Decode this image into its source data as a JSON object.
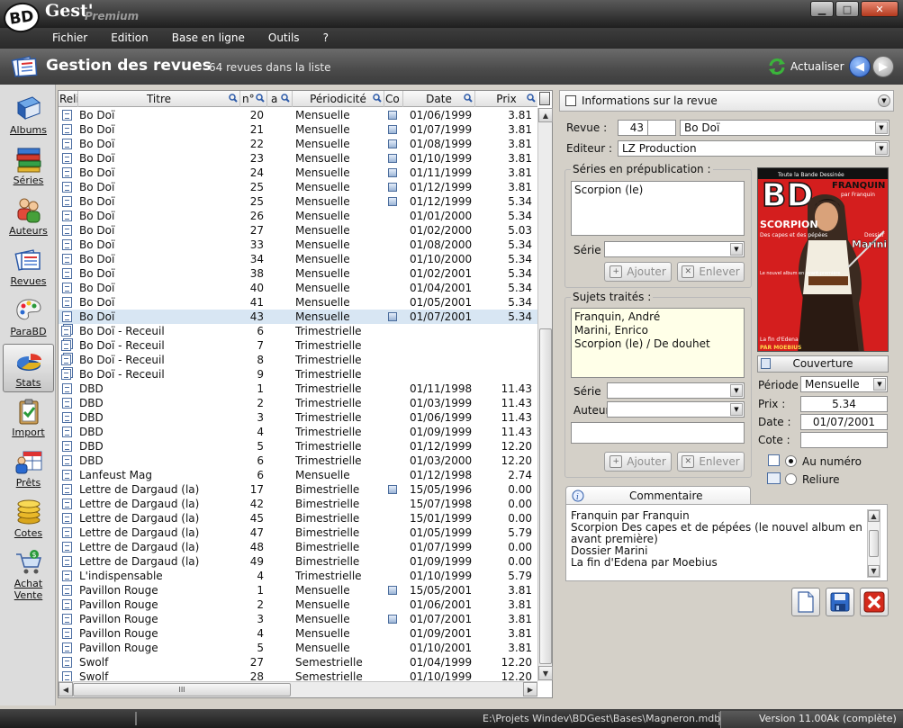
{
  "titlebar": {
    "logo_bd": "BD",
    "logo_gest": "Gest'",
    "logo_premium": "Premium"
  },
  "menu": [
    "Fichier",
    "Edition",
    "Base en ligne",
    "Outils",
    "?"
  ],
  "header": {
    "title": "Gestion des revues",
    "count": "64 revues dans la liste",
    "refresh": "Actualiser"
  },
  "sidebar": [
    {
      "label": "Albums",
      "icon": "book-icon"
    },
    {
      "label": "Séries",
      "icon": "stack-books-icon"
    },
    {
      "label": "Auteurs",
      "icon": "people-icon"
    },
    {
      "label": "Revues",
      "icon": "magazine-icon"
    },
    {
      "label": "ParaBD",
      "icon": "palette-icon"
    },
    {
      "label": "Stats",
      "icon": "pie-chart-icon"
    },
    {
      "label": "Import",
      "icon": "clipboard-icon"
    },
    {
      "label": "Prêts",
      "icon": "calendar-person-icon"
    },
    {
      "label": "Cotes",
      "icon": "coins-icon"
    },
    {
      "label": "Achat Vente",
      "icon": "cart-icon"
    }
  ],
  "list": {
    "columns": [
      "Reli",
      "Titre",
      "n°",
      "a",
      "Périodicité",
      "Co",
      "Date",
      "Prix"
    ],
    "rows": [
      [
        "Bo Doï",
        "20",
        "Mensuelle",
        "c",
        "01/06/1999",
        "3.81"
      ],
      [
        "Bo Doï",
        "21",
        "Mensuelle",
        "c",
        "01/07/1999",
        "3.81"
      ],
      [
        "Bo Doï",
        "22",
        "Mensuelle",
        "c",
        "01/08/1999",
        "3.81"
      ],
      [
        "Bo Doï",
        "23",
        "Mensuelle",
        "c",
        "01/10/1999",
        "3.81"
      ],
      [
        "Bo Doï",
        "24",
        "Mensuelle",
        "c",
        "01/11/1999",
        "3.81"
      ],
      [
        "Bo Doï",
        "25",
        "Mensuelle",
        "c",
        "01/12/1999",
        "3.81"
      ],
      [
        "Bo Doï",
        "25",
        "Mensuelle",
        "c",
        "01/12/1999",
        "5.34"
      ],
      [
        "Bo Doï",
        "26",
        "Mensuelle",
        "",
        "01/01/2000",
        "5.34"
      ],
      [
        "Bo Doï",
        "27",
        "Mensuelle",
        "",
        "01/02/2000",
        "5.03"
      ],
      [
        "Bo Doï",
        "33",
        "Mensuelle",
        "",
        "01/08/2000",
        "5.34"
      ],
      [
        "Bo Doï",
        "34",
        "Mensuelle",
        "",
        "01/10/2000",
        "5.34"
      ],
      [
        "Bo Doï",
        "38",
        "Mensuelle",
        "",
        "01/02/2001",
        "5.34"
      ],
      [
        "Bo Doï",
        "40",
        "Mensuelle",
        "",
        "01/04/2001",
        "5.34"
      ],
      [
        "Bo Doï",
        "41",
        "Mensuelle",
        "",
        "01/05/2001",
        "5.34"
      ],
      [
        "Bo Doï",
        "43",
        "Mensuelle",
        "c",
        "01/07/2001",
        "5.34"
      ],
      [
        "Bo Doï - Receuil",
        "6",
        "Trimestrielle",
        "",
        "",
        ""
      ],
      [
        "Bo Doï - Receuil",
        "7",
        "Trimestrielle",
        "",
        "",
        ""
      ],
      [
        "Bo Doï - Receuil",
        "8",
        "Trimestrielle",
        "",
        "",
        ""
      ],
      [
        "Bo Doï - Receuil",
        "9",
        "Trimestrielle",
        "",
        "",
        ""
      ],
      [
        "DBD",
        "1",
        "Trimestrielle",
        "",
        "01/11/1998",
        "11.43"
      ],
      [
        "DBD",
        "2",
        "Trimestrielle",
        "",
        "01/03/1999",
        "11.43"
      ],
      [
        "DBD",
        "3",
        "Trimestrielle",
        "",
        "01/06/1999",
        "11.43"
      ],
      [
        "DBD",
        "4",
        "Trimestrielle",
        "",
        "01/09/1999",
        "11.43"
      ],
      [
        "DBD",
        "5",
        "Trimestrielle",
        "",
        "01/12/1999",
        "12.20"
      ],
      [
        "DBD",
        "6",
        "Trimestrielle",
        "",
        "01/03/2000",
        "12.20"
      ],
      [
        "Lanfeust Mag",
        "6",
        "Mensuelle",
        "",
        "01/12/1998",
        "2.74"
      ],
      [
        "Lettre de Dargaud (la)",
        "17",
        "Bimestrielle",
        "c",
        "15/05/1996",
        "0.00"
      ],
      [
        "Lettre de Dargaud (la)",
        "42",
        "Bimestrielle",
        "",
        "15/07/1998",
        "0.00"
      ],
      [
        "Lettre de Dargaud (la)",
        "45",
        "Bimestrielle",
        "",
        "15/01/1999",
        "0.00"
      ],
      [
        "Lettre de Dargaud (la)",
        "47",
        "Bimestrielle",
        "",
        "01/05/1999",
        "5.79"
      ],
      [
        "Lettre de Dargaud (la)",
        "48",
        "Bimestrielle",
        "",
        "01/07/1999",
        "0.00"
      ],
      [
        "Lettre de Dargaud (la)",
        "49",
        "Bimestrielle",
        "",
        "01/09/1999",
        "0.00"
      ],
      [
        "L'indispensable",
        "4",
        "Trimestrielle",
        "",
        "01/10/1999",
        "5.79"
      ],
      [
        "Pavillon Rouge",
        "1",
        "Mensuelle",
        "c",
        "15/05/2001",
        "3.81"
      ],
      [
        "Pavillon Rouge",
        "2",
        "Mensuelle",
        "",
        "01/06/2001",
        "3.81"
      ],
      [
        "Pavillon Rouge",
        "3",
        "Mensuelle",
        "c",
        "01/07/2001",
        "3.81"
      ],
      [
        "Pavillon Rouge",
        "4",
        "Mensuelle",
        "",
        "01/09/2001",
        "3.81"
      ],
      [
        "Pavillon Rouge",
        "5",
        "Mensuelle",
        "",
        "01/10/2001",
        "3.81"
      ],
      [
        "Swolf",
        "27",
        "Semestrielle",
        "",
        "01/04/1999",
        "12.20"
      ],
      [
        "Swolf",
        "28",
        "Semestrielle",
        "",
        "01/10/1999",
        "12.20"
      ]
    ],
    "selected_index": 14,
    "receuil_rows": [
      15,
      16,
      17,
      18
    ],
    "hscroll_label": "III"
  },
  "info": {
    "header": "Informations sur la revue",
    "revue_label": "Revue :",
    "revue_num": "43",
    "revue_title": "Bo Doï",
    "editeur_label": "Editeur :",
    "editeur": "LZ Production",
    "series_group": "Séries en prépublication :",
    "series_items": [
      "Scorpion (le)"
    ],
    "serie_label": "Série",
    "ajouter": "Ajouter",
    "enlever": "Enlever",
    "sujets_group": "Sujets traités :",
    "sujets_items": [
      "Franquin, André",
      "Marini, Enrico",
      "Scorpion (le) / De douhet"
    ],
    "auteur_label": "Auteur",
    "couverture": "Couverture",
    "periode_label": "Période",
    "periode": "Mensuelle",
    "prix_label": "Prix :",
    "prix": "5.34",
    "date_label": "Date :",
    "date": "01/07/2001",
    "cote_label": "Cote :",
    "cote": "",
    "radio_numero": "Au numéro",
    "radio_reliure": "Reliure",
    "cover": {
      "brand": "BD",
      "subtitle": "Toute la Bande Dessinée",
      "headline1": "FRANQUIN",
      "headline1_sub": "par Franquin",
      "scorpion": "SCORPION",
      "scorpion_sub": "Des capes et des pépées",
      "marini_label": "Dossier",
      "marini": "Marini",
      "small_text": "Le nouvel album en avant-première",
      "edena": "La fin d'Edena",
      "moebius": "PAR MOEBIUS"
    },
    "comment_tab": "Commentaire",
    "comment_lines": [
      "Franquin par Franquin",
      "Scorpion Des capes et de pépées (le nouvel album en",
      "avant première)",
      "Dossier Marini",
      "La fin d'Edena par Moebius"
    ]
  },
  "status": {
    "path": "E:\\Projets Windev\\BDGest\\Bases\\Magneron.mdb",
    "version": "Version 11.00Ak (complète)"
  },
  "colors": {
    "selected_row": "#d8e6f3",
    "header_band": "#4a4a4a",
    "subject_bg": "#ffffe8"
  }
}
